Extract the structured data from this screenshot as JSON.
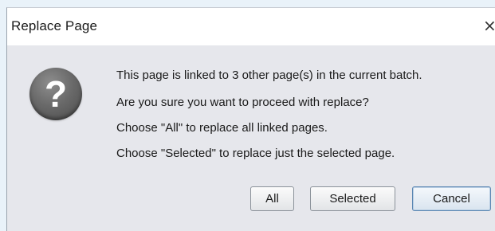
{
  "window": {
    "title": "Replace Page",
    "close_glyph": "×"
  },
  "icon": {
    "name": "question-icon",
    "glyph": "?"
  },
  "message": {
    "lines": [
      "This page is linked to 3 other page(s) in the current batch.",
      "Are you sure you want to proceed with replace?",
      "Choose \"All\" to replace all linked pages.",
      "Choose \"Selected\" to replace just the selected page."
    ]
  },
  "buttons": {
    "all": "All",
    "selected": "Selected",
    "cancel": "Cancel"
  },
  "colors": {
    "dialog_bg": "#e6e7ec",
    "titlebar_bg": "#ffffff",
    "default_button_border": "#5b87b3"
  }
}
